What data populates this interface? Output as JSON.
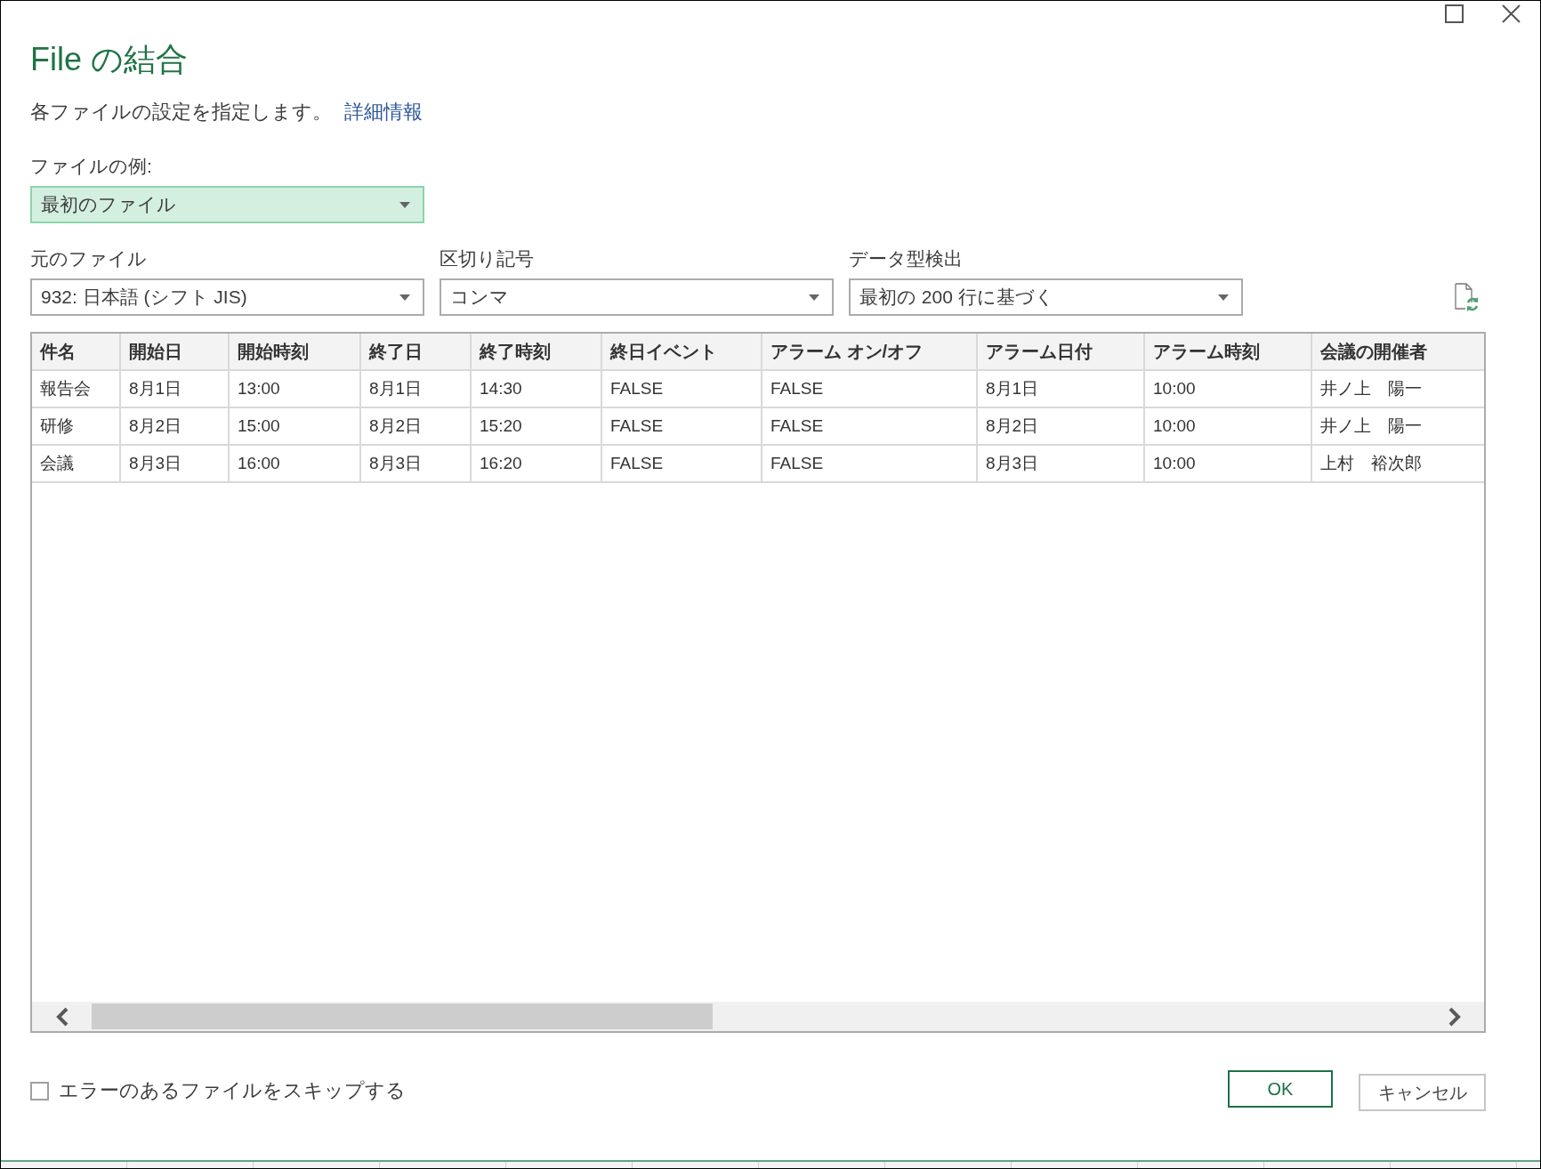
{
  "window": {
    "title": "File の結合"
  },
  "description": {
    "text": "各ファイルの設定を指定します。",
    "link": "詳細情報"
  },
  "sample_file": {
    "label": "ファイルの例:",
    "value": "最初のファイル",
    "focused": true
  },
  "settings": [
    {
      "label": "元のファイル",
      "value": "932: 日本語 (シフト JIS)"
    },
    {
      "label": "区切り記号",
      "value": "コンマ"
    },
    {
      "label": "データ型検出",
      "value": "最初の 200 行に基づく"
    }
  ],
  "table": {
    "columns": [
      "件名",
      "開始日",
      "開始時刻",
      "終了日",
      "終了時刻",
      "終日イベント",
      "アラーム オン/オフ",
      "アラーム日付",
      "アラーム時刻",
      "会議の開催者"
    ],
    "rows": [
      [
        "報告会",
        "8月1日",
        "13:00",
        "8月1日",
        "14:30",
        "FALSE",
        "FALSE",
        "8月1日",
        "10:00",
        "井ノ上　陽一"
      ],
      [
        "研修",
        "8月2日",
        "15:00",
        "8月2日",
        "15:20",
        "FALSE",
        "FALSE",
        "8月2日",
        "10:00",
        "井ノ上　陽一"
      ],
      [
        "会議",
        "8月3日",
        "16:00",
        "8月3日",
        "16:20",
        "FALSE",
        "FALSE",
        "8月3日",
        "10:00",
        "上村　裕次郎"
      ]
    ]
  },
  "skip_errors": {
    "label": "エラーのあるファイルをスキップする",
    "checked": false
  },
  "buttons": [
    {
      "label": "OK",
      "kind": "primary"
    },
    {
      "label": "キャンセル",
      "kind": "secondary"
    }
  ]
}
